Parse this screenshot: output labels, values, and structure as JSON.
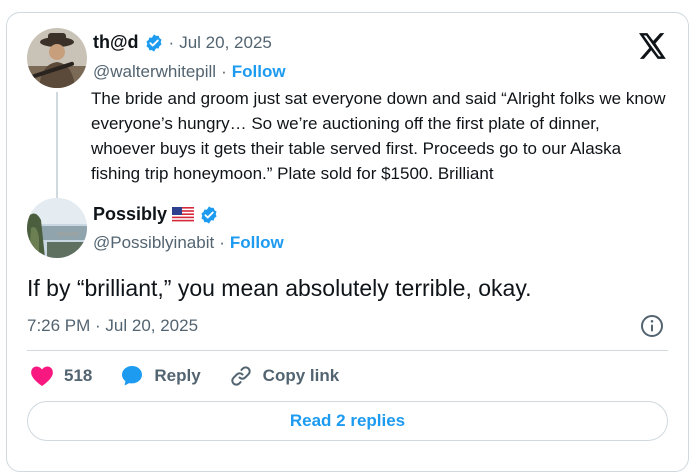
{
  "quoted": {
    "name": "th@d",
    "date": "Jul 20, 2025",
    "dot": "·",
    "handle": "@walterwhitepill",
    "follow_label": "Follow",
    "text": "The bride and groom just sat everyone down and said “Alright folks we know everyone’s hungry… So we’re auctioning off the first plate of dinner, whoever buys it gets their table served first. Proceeds go to our Alaska fishing trip honeymoon.” Plate sold for $1500. Brilliant"
  },
  "main": {
    "name": "Possibly",
    "handle": "@Possiblyinabit",
    "dot": "·",
    "follow_label": "Follow",
    "text": "If by “brilliant,” you mean absolutely terrible, okay.",
    "timestamp": "7:26 PM · Jul 20, 2025"
  },
  "actions": {
    "like_count": "518",
    "reply_label": "Reply",
    "copy_link_label": "Copy link"
  },
  "read_replies_label": "Read 2 replies",
  "colors": {
    "accent": "#1d9bf0",
    "like": "#f91880",
    "text": "#0f1419",
    "muted": "#536471",
    "border": "#cfd9de"
  },
  "icons": [
    "x-logo-icon",
    "verified-badge-icon",
    "us-flag-icon",
    "heart-icon",
    "reply-bubble-icon",
    "link-icon",
    "info-icon"
  ]
}
